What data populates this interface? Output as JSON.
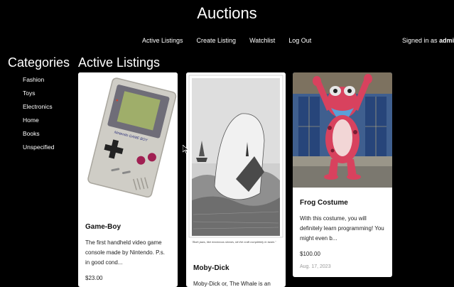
{
  "header": {
    "title": "Auctions"
  },
  "nav": {
    "items": [
      "Active Listings",
      "Create Listing",
      "Watchlist",
      "Log Out"
    ],
    "signed_in_prefix": "Signed in as",
    "username": "admin."
  },
  "sidebar": {
    "heading": "Categories",
    "categories": [
      "Fashion",
      "Toys",
      "Electronics",
      "Home",
      "Books",
      "Unspecified"
    ]
  },
  "main": {
    "heading": "Active Listings",
    "listings": [
      {
        "title": "Game-Boy",
        "description": "The first handheld video game console made by Nintendo. P.s. in good cond...",
        "price": "$23.00",
        "image_icon": "gameboy-image"
      },
      {
        "title": "Moby-Dick",
        "description": "Moby-Dick or, The Whale is an",
        "image_icon": "whale-illustration",
        "image_caption": "\"Both jaws, like enormous shears, bit the craft completely in twain.\""
      },
      {
        "title": "Frog Costume",
        "description": "With this costume, you will definitely learn programming! You might even b...",
        "price": "$100.00",
        "date": "Aug. 17, 2023",
        "image_icon": "frog-costume-photo"
      }
    ]
  }
}
